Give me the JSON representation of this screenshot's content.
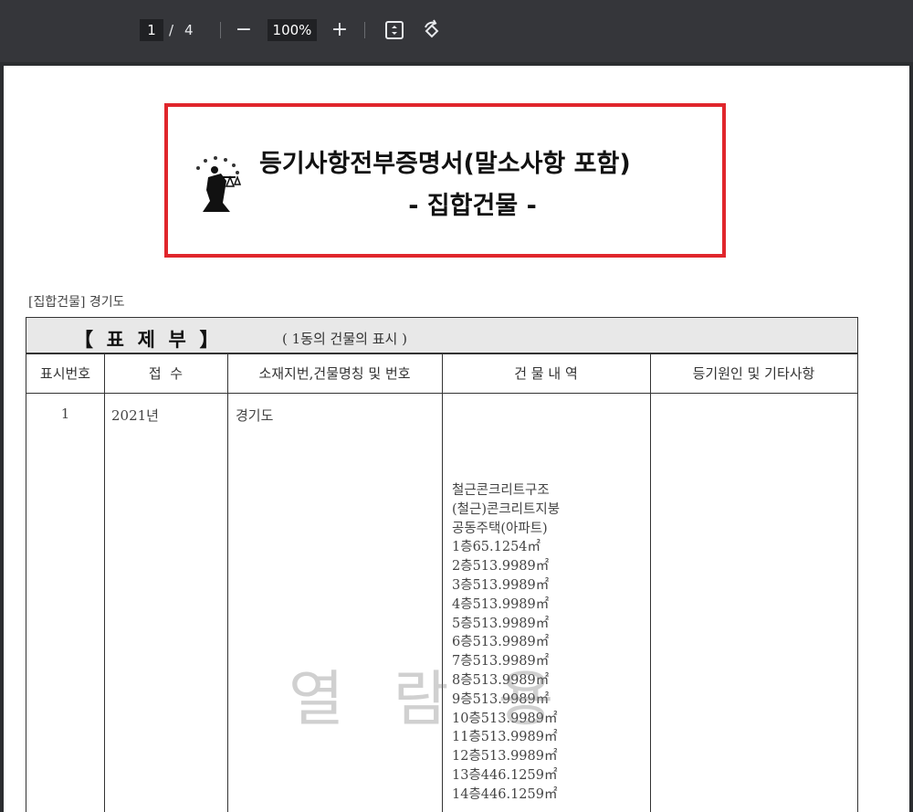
{
  "toolbar": {
    "current_page": "1",
    "page_separator": "/",
    "total_pages": "4",
    "zoom_out_label": "−",
    "zoom_level": "100%",
    "zoom_in_label": "+",
    "fit_icon": "fit-to-page-icon",
    "rotate_icon": "rotate-icon"
  },
  "document": {
    "title_main": "등기사항전부증명서(말소사항 포함)",
    "title_sub": "- 집합건물 -",
    "emblem_icon": "court-emblem-icon",
    "section_label": "[집합건물] 경기도",
    "band_title": "【  표  제  부  】",
    "band_subtitle": "( 1동의 건물의 표시 )",
    "headers": [
      "표시번호",
      "접  수",
      "소재지번,건물명칭 및 번호",
      "건 물 내 역",
      "등기원인 및 기타사항"
    ],
    "row": {
      "number": "1",
      "reception": "2021년",
      "location": "경기도",
      "building_details": [
        "철근콘크리트구조",
        "(철근)콘크리트지붕",
        "공동주택(아파트)",
        "1층65.1254㎡",
        "2층513.9989㎡",
        "3층513.9989㎡",
        "4층513.9989㎡",
        "5층513.9989㎡",
        "6층513.9989㎡",
        "7층513.9989㎡",
        "8층513.9989㎡",
        "9층513.9989㎡",
        "10층513.9989㎡",
        "11층513.9989㎡",
        "12층513.9989㎡",
        "13층446.1259㎡",
        "14층446.1259㎡"
      ]
    },
    "watermark": "열람용"
  }
}
